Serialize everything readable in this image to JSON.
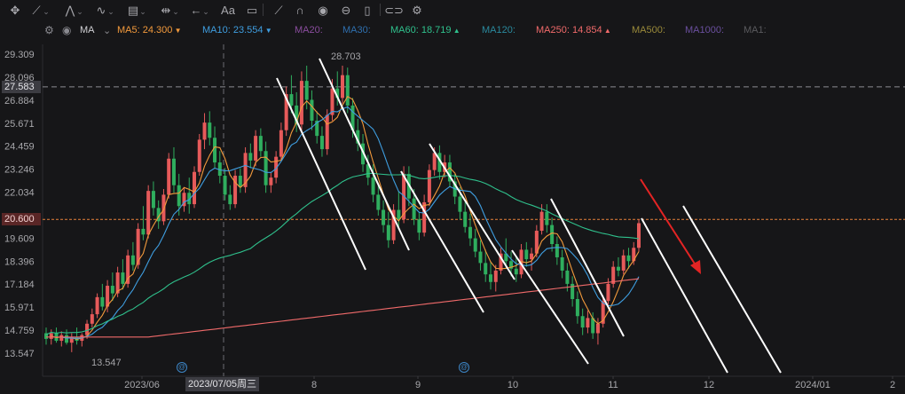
{
  "toolbar": {
    "icons": [
      "crosshair-icon",
      "line-tool-icon",
      "pattern-tool-icon",
      "wave-tool-icon",
      "fibonacci-tool-icon",
      "measure-tool-icon",
      "arrow-tool-icon",
      "text-tool-icon",
      "note-tool-icon",
      "pen-tool-icon",
      "magnet-icon",
      "eye-icon",
      "lock-icon",
      "trash-icon",
      "link-icon",
      "settings-icon"
    ],
    "text_tool_label": "Aa"
  },
  "legend": {
    "selector": "MA",
    "items": [
      {
        "label": "MA5:",
        "value": "24.300",
        "arrow": "▼",
        "color": "#f39a3c"
      },
      {
        "label": "MA10:",
        "value": "23.554",
        "arrow": "▼",
        "color": "#3f9ee0"
      },
      {
        "label": "MA20:",
        "value": "",
        "arrow": "",
        "color": "#8a4d9e"
      },
      {
        "label": "MA30:",
        "value": "",
        "arrow": "",
        "color": "#2f6fae"
      },
      {
        "label": "MA60:",
        "value": "18.719",
        "arrow": "▲",
        "color": "#2fc08c"
      },
      {
        "label": "MA120:",
        "value": "",
        "arrow": "",
        "color": "#2a8a9e"
      },
      {
        "label": "MA250:",
        "value": "14.854",
        "arrow": "▲",
        "color": "#f06a6a"
      },
      {
        "label": "MA500:",
        "value": "",
        "arrow": "",
        "color": "#9a8a3a"
      },
      {
        "label": "MA1000:",
        "value": "",
        "arrow": "",
        "color": "#6a4f9e"
      },
      {
        "label": "MA1:",
        "value": "",
        "arrow": "",
        "color": "#5a5a5e"
      }
    ]
  },
  "price_tags": {
    "crosshair": "27.583",
    "current": "20.600"
  },
  "crosshair_date": "2023/07/05周三",
  "annotations": {
    "high": "28.703",
    "low": "13.547"
  },
  "markers": [
    "@",
    "@"
  ],
  "colors": {
    "up": "#e65a5a",
    "down": "#2fae5e",
    "current_line": "#e8823a",
    "trend_lines": "#ffffff",
    "arrow": "#e42424"
  },
  "chart_data": {
    "type": "candlestick",
    "y_ticks": [
      "29.309",
      "28.096",
      "27.583",
      "26.884",
      "25.671",
      "24.459",
      "23.246",
      "22.034",
      "20.600",
      "19.609",
      "18.396",
      "17.184",
      "15.971",
      "14.759",
      "13.547"
    ],
    "x_ticks": [
      "2023/06",
      "8",
      "9",
      "10",
      "11",
      "12",
      "2024/01",
      "2"
    ],
    "ylim": [
      12.9,
      29.8
    ],
    "current_price": 20.6,
    "crosshair_price": 27.583,
    "crosshair_date": "2023/07/05",
    "high": 28.703,
    "low": 13.547,
    "ohlc": [
      [
        14.6,
        14.9,
        14.0,
        14.3
      ],
      [
        14.3,
        14.8,
        14.0,
        14.6
      ],
      [
        14.6,
        14.9,
        14.1,
        14.2
      ],
      [
        14.2,
        14.7,
        13.9,
        14.5
      ],
      [
        14.5,
        14.8,
        14.0,
        14.1
      ],
      [
        14.1,
        14.6,
        13.6,
        14.4
      ],
      [
        14.4,
        14.9,
        14.0,
        14.2
      ],
      [
        14.2,
        14.6,
        13.9,
        14.5
      ],
      [
        14.5,
        15.3,
        14.3,
        15.1
      ],
      [
        15.1,
        15.9,
        14.9,
        15.6
      ],
      [
        15.6,
        16.7,
        15.4,
        16.5
      ],
      [
        16.5,
        17.2,
        15.8,
        16.0
      ],
      [
        16.0,
        17.4,
        15.7,
        17.1
      ],
      [
        17.1,
        17.8,
        16.3,
        16.7
      ],
      [
        16.7,
        18.1,
        16.5,
        17.8
      ],
      [
        17.8,
        18.5,
        16.9,
        17.2
      ],
      [
        17.2,
        19.0,
        17.0,
        18.7
      ],
      [
        18.7,
        19.4,
        17.9,
        18.2
      ],
      [
        18.2,
        20.4,
        18.0,
        20.1
      ],
      [
        20.1,
        21.3,
        19.5,
        19.8
      ],
      [
        19.8,
        22.4,
        19.6,
        22.1
      ],
      [
        22.1,
        22.6,
        20.8,
        21.2
      ],
      [
        21.2,
        21.6,
        20.1,
        20.5
      ],
      [
        20.5,
        22.2,
        20.3,
        21.9
      ],
      [
        21.9,
        24.1,
        21.7,
        23.8
      ],
      [
        23.8,
        24.4,
        22.0,
        22.4
      ],
      [
        22.4,
        23.0,
        20.8,
        21.3
      ],
      [
        21.3,
        22.3,
        21.0,
        22.0
      ],
      [
        22.0,
        22.8,
        20.9,
        21.4
      ],
      [
        21.4,
        23.4,
        21.2,
        23.1
      ],
      [
        23.1,
        25.1,
        22.9,
        24.8
      ],
      [
        24.8,
        26.2,
        24.3,
        25.7
      ],
      [
        25.7,
        26.3,
        24.5,
        24.9
      ],
      [
        24.9,
        25.5,
        23.3,
        23.6
      ],
      [
        23.6,
        24.2,
        22.5,
        22.9
      ],
      [
        22.9,
        23.3,
        21.6,
        21.9
      ],
      [
        21.9,
        22.4,
        21.1,
        21.4
      ],
      [
        21.4,
        23.2,
        21.2,
        22.9
      ],
      [
        22.9,
        23.3,
        22.0,
        22.3
      ],
      [
        22.3,
        24.4,
        22.0,
        24.1
      ],
      [
        24.1,
        24.6,
        23.3,
        23.7
      ],
      [
        23.7,
        25.3,
        23.4,
        25.0
      ],
      [
        25.0,
        25.4,
        23.9,
        24.2
      ],
      [
        24.2,
        24.7,
        22.0,
        22.4
      ],
      [
        22.4,
        23.1,
        22.0,
        22.8
      ],
      [
        22.8,
        24.2,
        22.5,
        23.9
      ],
      [
        23.9,
        25.7,
        23.7,
        25.3
      ],
      [
        25.3,
        27.6,
        25.0,
        27.2
      ],
      [
        27.2,
        28.2,
        26.2,
        26.6
      ],
      [
        26.6,
        27.3,
        25.2,
        25.6
      ],
      [
        25.6,
        28.4,
        25.3,
        27.9
      ],
      [
        27.9,
        28.7,
        26.4,
        26.9
      ],
      [
        26.9,
        27.4,
        25.3,
        25.8
      ],
      [
        25.8,
        26.3,
        24.6,
        25.0
      ],
      [
        25.0,
        25.5,
        23.9,
        24.3
      ],
      [
        24.3,
        26.4,
        24.0,
        26.1
      ],
      [
        26.1,
        28.0,
        25.8,
        27.5
      ],
      [
        27.5,
        28.4,
        26.6,
        27.0
      ],
      [
        27.0,
        28.7,
        26.7,
        28.2
      ],
      [
        28.2,
        28.6,
        26.2,
        26.6
      ],
      [
        26.6,
        27.0,
        24.9,
        25.3
      ],
      [
        25.3,
        25.9,
        24.2,
        24.6
      ],
      [
        24.6,
        25.1,
        23.1,
        23.5
      ],
      [
        23.5,
        24.0,
        22.4,
        22.8
      ],
      [
        22.8,
        23.5,
        21.5,
        21.9
      ],
      [
        21.9,
        22.4,
        20.8,
        21.1
      ],
      [
        21.1,
        21.6,
        19.9,
        20.3
      ],
      [
        20.3,
        21.0,
        19.1,
        19.5
      ],
      [
        19.5,
        21.4,
        19.3,
        21.1
      ],
      [
        21.1,
        22.1,
        20.1,
        20.6
      ],
      [
        20.6,
        23.4,
        20.4,
        23.0
      ],
      [
        23.0,
        23.4,
        21.3,
        21.7
      ],
      [
        21.7,
        22.2,
        20.3,
        20.6
      ],
      [
        20.6,
        21.0,
        19.5,
        19.9
      ],
      [
        19.9,
        21.9,
        19.7,
        21.5
      ],
      [
        21.5,
        23.5,
        21.3,
        23.2
      ],
      [
        23.2,
        24.4,
        22.9,
        24.1
      ],
      [
        24.1,
        24.5,
        22.7,
        23.1
      ],
      [
        23.1,
        24.0,
        22.8,
        23.6
      ],
      [
        23.6,
        24.0,
        22.3,
        22.6
      ],
      [
        22.6,
        23.0,
        21.4,
        21.8
      ],
      [
        21.8,
        22.3,
        20.6,
        21.0
      ],
      [
        21.0,
        21.5,
        19.9,
        20.2
      ],
      [
        20.2,
        20.9,
        19.2,
        19.6
      ],
      [
        19.6,
        20.1,
        18.6,
        18.9
      ],
      [
        18.9,
        19.5,
        17.9,
        18.3
      ],
      [
        18.3,
        19.0,
        17.3,
        17.7
      ],
      [
        17.7,
        18.4,
        16.9,
        17.3
      ],
      [
        17.3,
        18.2,
        16.8,
        17.9
      ],
      [
        17.9,
        19.1,
        17.7,
        18.8
      ],
      [
        18.8,
        19.6,
        18.0,
        18.4
      ],
      [
        18.4,
        18.9,
        17.6,
        18.0
      ],
      [
        18.0,
        18.6,
        17.3,
        17.7
      ],
      [
        17.7,
        19.3,
        17.5,
        19.0
      ],
      [
        19.0,
        19.4,
        18.1,
        18.5
      ],
      [
        18.5,
        19.1,
        17.9,
        18.8
      ],
      [
        18.8,
        20.3,
        18.6,
        20.0
      ],
      [
        20.0,
        21.4,
        19.8,
        21.0
      ],
      [
        21.0,
        21.4,
        19.9,
        20.3
      ],
      [
        20.3,
        20.7,
        18.9,
        19.3
      ],
      [
        19.3,
        19.7,
        18.2,
        18.6
      ],
      [
        18.6,
        19.0,
        17.5,
        17.9
      ],
      [
        17.9,
        18.3,
        16.8,
        17.2
      ],
      [
        17.2,
        17.6,
        16.0,
        16.4
      ],
      [
        16.4,
        16.8,
        15.1,
        15.5
      ],
      [
        15.5,
        15.9,
        14.5,
        14.9
      ],
      [
        14.9,
        15.8,
        14.6,
        15.4
      ],
      [
        15.4,
        15.7,
        14.3,
        14.6
      ],
      [
        14.6,
        15.4,
        14.0,
        15.1
      ],
      [
        15.1,
        16.6,
        14.9,
        16.3
      ],
      [
        16.3,
        17.5,
        16.1,
        17.2
      ],
      [
        17.2,
        18.4,
        17.0,
        18.1
      ],
      [
        18.1,
        18.6,
        17.6,
        17.9
      ],
      [
        17.9,
        19.0,
        17.7,
        18.7
      ],
      [
        18.7,
        19.1,
        18.0,
        18.4
      ],
      [
        18.4,
        19.4,
        18.2,
        19.1
      ],
      [
        19.1,
        20.6,
        18.9,
        20.4
      ]
    ],
    "series": [
      {
        "name": "MA5",
        "value": 24.3
      },
      {
        "name": "MA10",
        "value": 23.554
      },
      {
        "name": "MA60",
        "value": 18.719
      },
      {
        "name": "MA250",
        "value": 14.854
      }
    ]
  }
}
